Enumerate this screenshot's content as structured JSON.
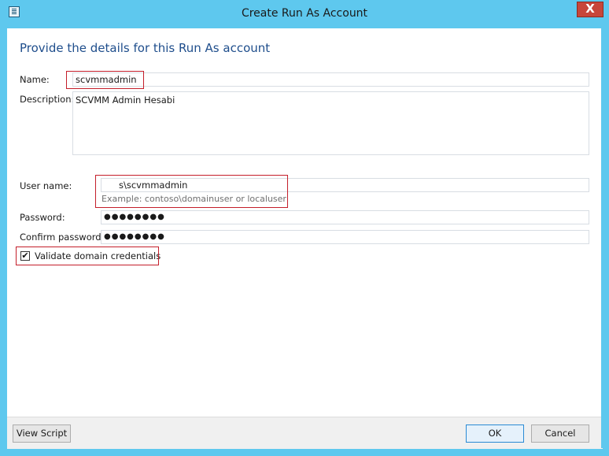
{
  "window": {
    "title": "Create Run As Account",
    "close_glyph": "X"
  },
  "main": {
    "heading": "Provide the details for this Run As account",
    "name_label": "Name:",
    "name_value": "scvmmadmin",
    "description_label": "Description:",
    "description_value": "SCVMM Admin Hesabi",
    "username_label": "User name:",
    "username_value": "s\\scvmmadmin",
    "username_example": "Example: contoso\\domainuser or localuser",
    "password_label": "Password:",
    "password_value": "●●●●●●●●",
    "confirm_label": "Confirm password:",
    "confirm_value": "●●●●●●●●",
    "validate_label": "Validate domain credentials",
    "validate_checked": true,
    "check_glyph": "✔"
  },
  "footer": {
    "view_script": "View Script",
    "ok": "OK",
    "cancel": "Cancel"
  },
  "colors": {
    "frame": "#5ec8ee",
    "heading": "#1f4e8c",
    "highlight": "#c41e2a",
    "close": "#c7463a"
  }
}
